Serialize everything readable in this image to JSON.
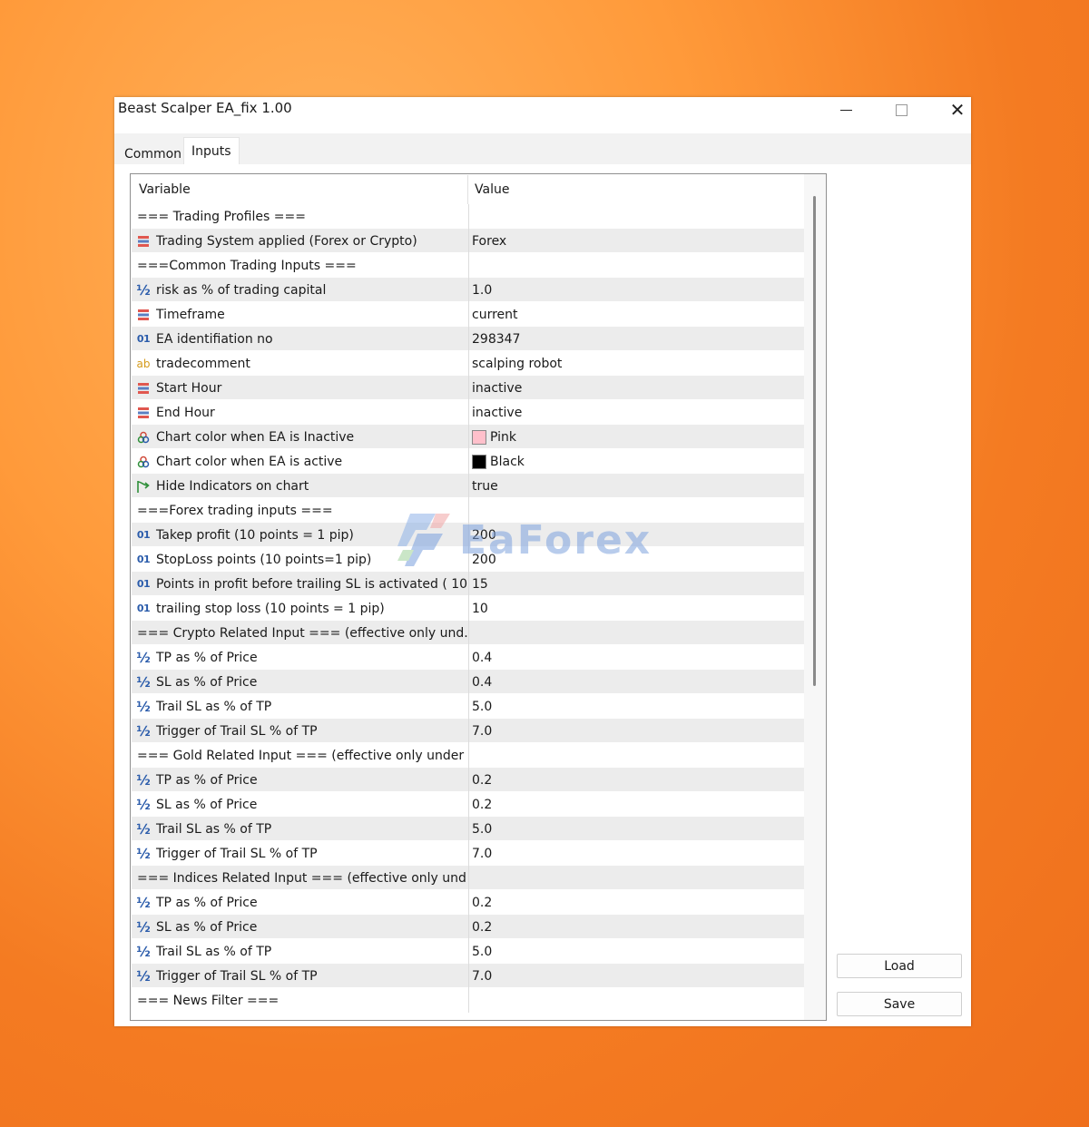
{
  "window": {
    "title": "Beast Scalper EA_fix 1.00",
    "minimize_glyph": "—",
    "maximize_glyph": "☐",
    "close_glyph": "✕"
  },
  "tabs": [
    {
      "label": "Common",
      "selected": false
    },
    {
      "label": "Inputs",
      "selected": true
    }
  ],
  "grid": {
    "col_variable": "Variable",
    "col_value": "Value",
    "rows": [
      {
        "icon": "none",
        "variable": "=== Trading Profiles ===",
        "value": ""
      },
      {
        "icon": "list-icon",
        "variable": "Trading System applied (Forex or Crypto)",
        "value": "Forex"
      },
      {
        "icon": "none",
        "variable": "===Common Trading Inputs ===",
        "value": ""
      },
      {
        "icon": "fraction-icon",
        "variable": "risk as % of trading capital",
        "value": "1.0"
      },
      {
        "icon": "list-icon",
        "variable": "Timeframe",
        "value": "current"
      },
      {
        "icon": "integer-icon",
        "variable": "EA identifiation no",
        "value": "298347"
      },
      {
        "icon": "string-icon",
        "variable": "tradecomment",
        "value": "scalping robot"
      },
      {
        "icon": "list-icon",
        "variable": "Start Hour",
        "value": "inactive"
      },
      {
        "icon": "list-icon",
        "variable": "End Hour",
        "value": "inactive"
      },
      {
        "icon": "color-icon",
        "variable": "Chart color when EA is Inactive",
        "value": "Pink",
        "swatch": "#ffc0cb"
      },
      {
        "icon": "color-icon",
        "variable": "Chart color when EA is active",
        "value": "Black",
        "swatch": "#000000"
      },
      {
        "icon": "bool-icon",
        "variable": "Hide Indicators on chart",
        "value": "true"
      },
      {
        "icon": "none",
        "variable": "===Forex trading inputs ===",
        "value": ""
      },
      {
        "icon": "integer-icon",
        "variable": "Takep profit (10 points = 1 pip)",
        "value": "200"
      },
      {
        "icon": "integer-icon",
        "variable": "StopLoss points (10 points=1 pip)",
        "value": "200"
      },
      {
        "icon": "integer-icon",
        "variable": "Points in profit before trailing SL is activated ( 10 ...",
        "value": "15"
      },
      {
        "icon": "integer-icon",
        "variable": "trailing stop loss (10 points = 1 pip)",
        "value": "10"
      },
      {
        "icon": "none",
        "variable": "=== Crypto Related Input === (effective only und...",
        "value": ""
      },
      {
        "icon": "fraction-icon",
        "variable": "TP as % of Price",
        "value": "0.4"
      },
      {
        "icon": "fraction-icon",
        "variable": "SL as % of Price",
        "value": "0.4"
      },
      {
        "icon": "fraction-icon",
        "variable": "Trail SL as % of TP",
        "value": "5.0"
      },
      {
        "icon": "fraction-icon",
        "variable": "Trigger of Trail SL % of TP",
        "value": "7.0"
      },
      {
        "icon": "none",
        "variable": "=== Gold Related Input === (effective only under ...",
        "value": ""
      },
      {
        "icon": "fraction-icon",
        "variable": "TP as % of Price",
        "value": "0.2"
      },
      {
        "icon": "fraction-icon",
        "variable": "SL as % of Price",
        "value": "0.2"
      },
      {
        "icon": "fraction-icon",
        "variable": "Trail SL as % of TP",
        "value": "5.0"
      },
      {
        "icon": "fraction-icon",
        "variable": "Trigger of Trail SL % of TP",
        "value": "7.0"
      },
      {
        "icon": "none",
        "variable": "=== Indices Related Input === (effective only und...",
        "value": ""
      },
      {
        "icon": "fraction-icon",
        "variable": "TP as % of Price",
        "value": "0.2"
      },
      {
        "icon": "fraction-icon",
        "variable": "SL as % of Price",
        "value": "0.2"
      },
      {
        "icon": "fraction-icon",
        "variable": "Trail SL as % of TP",
        "value": "5.0"
      },
      {
        "icon": "fraction-icon",
        "variable": "Trigger of Trail SL % of TP",
        "value": "7.0"
      },
      {
        "icon": "none",
        "variable": "=== News Filter ===",
        "value": ""
      }
    ]
  },
  "buttons": {
    "load_label": "Load",
    "save_label": "Save"
  },
  "watermark": {
    "text": "EaForex"
  },
  "colors": {
    "background_orange": "#f47b22",
    "row_alt": "#ececec",
    "icon_blue": "#2b5cab"
  }
}
